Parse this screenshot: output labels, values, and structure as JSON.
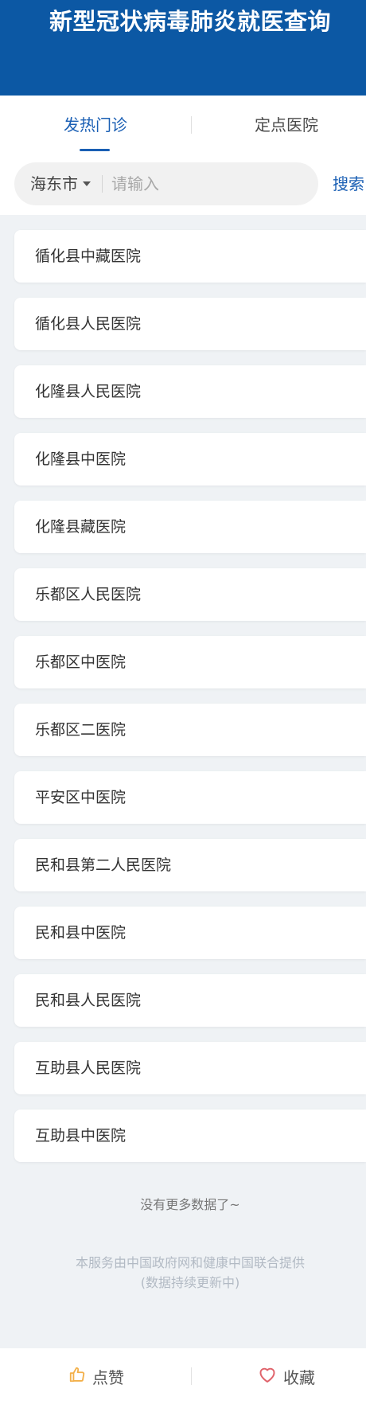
{
  "header": {
    "title": "新型冠状病毒肺炎就医查询"
  },
  "tabs": [
    {
      "label": "发热门诊",
      "active": true
    },
    {
      "label": "定点医院",
      "active": false
    }
  ],
  "search": {
    "city": "海东市",
    "placeholder": "请输入",
    "value": "",
    "button_label": "搜索"
  },
  "hospitals": [
    "循化县中藏医院",
    "循化县人民医院",
    "化隆县人民医院",
    "化隆县中医院",
    "化隆县藏医院",
    "乐都区人民医院",
    "乐都区中医院",
    "乐都区二医院",
    "平安区中医院",
    "民和县第二人民医院",
    "民和县中医院",
    "民和县人民医院",
    "互助县人民医院",
    "互助县中医院"
  ],
  "list_end": "没有更多数据了~",
  "footer": {
    "line1": "本服务由中国政府网和健康中国联合提供",
    "line2": "(数据持续更新中)"
  },
  "bottom_bar": {
    "like_label": "点赞",
    "favorite_label": "收藏"
  },
  "colors": {
    "header": "#0c58a4",
    "accent": "#1a5fb4",
    "like_icon": "#f3b04a",
    "favorite_icon": "#e0636b"
  },
  "icons": {
    "like": "thumbs-up-icon",
    "favorite": "heart-icon",
    "dropdown": "caret-down-icon"
  }
}
